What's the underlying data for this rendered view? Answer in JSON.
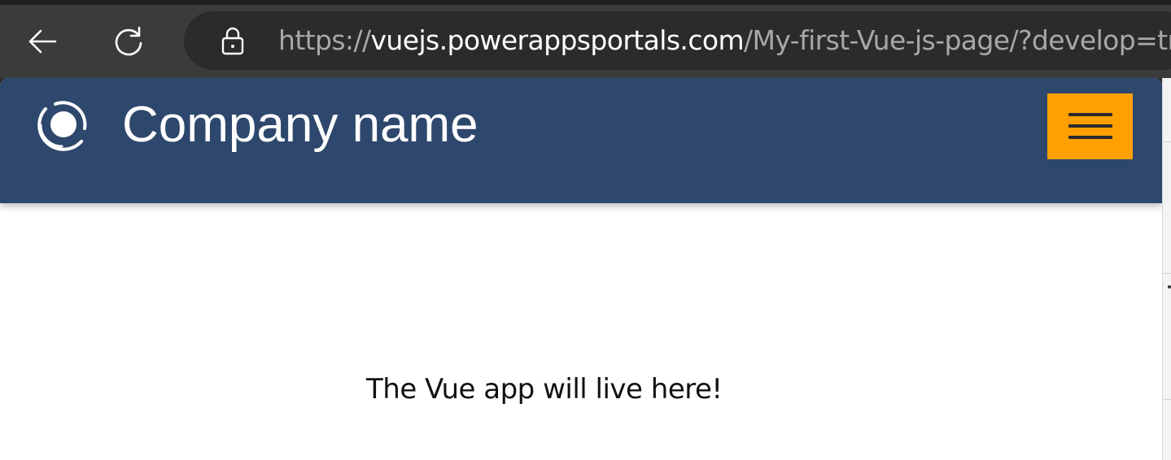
{
  "browser": {
    "url": {
      "scheme": "https://",
      "host": "vuejs.powerappsportals.com",
      "path": "/My-first-Vue-js-page/?develop=true"
    },
    "icons": {
      "back": "back-arrow-icon",
      "reload": "reload-icon",
      "lock": "lock-icon"
    }
  },
  "site": {
    "brand": "Company name",
    "logo_icon": "company-logo-icon",
    "menu_icon": "hamburger-menu-icon",
    "colors": {
      "header_bg": "#2e476d",
      "menu_button": "#ffa000"
    }
  },
  "main": {
    "placeholder_text": "The Vue app will live here!"
  }
}
